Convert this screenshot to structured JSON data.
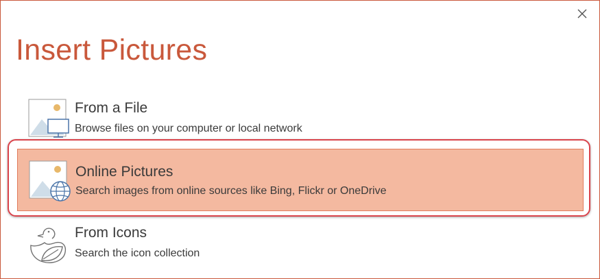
{
  "dialog": {
    "title": "Insert Pictures",
    "close_icon": "close-icon"
  },
  "options": [
    {
      "label": "From a File",
      "description": "Browse files on your computer or local network",
      "icon": "picture-computer-icon"
    },
    {
      "label": "Online Pictures",
      "description": "Search images from online sources like Bing, Flickr or OneDrive",
      "icon": "picture-globe-icon",
      "selected": true
    },
    {
      "label": "From Icons",
      "description": "Search the icon collection",
      "icon": "duck-leaf-icon"
    }
  ],
  "colors": {
    "accent": "#c9583b",
    "selected_bg": "#f4b9a0",
    "highlight_ring": "#d9434b"
  }
}
